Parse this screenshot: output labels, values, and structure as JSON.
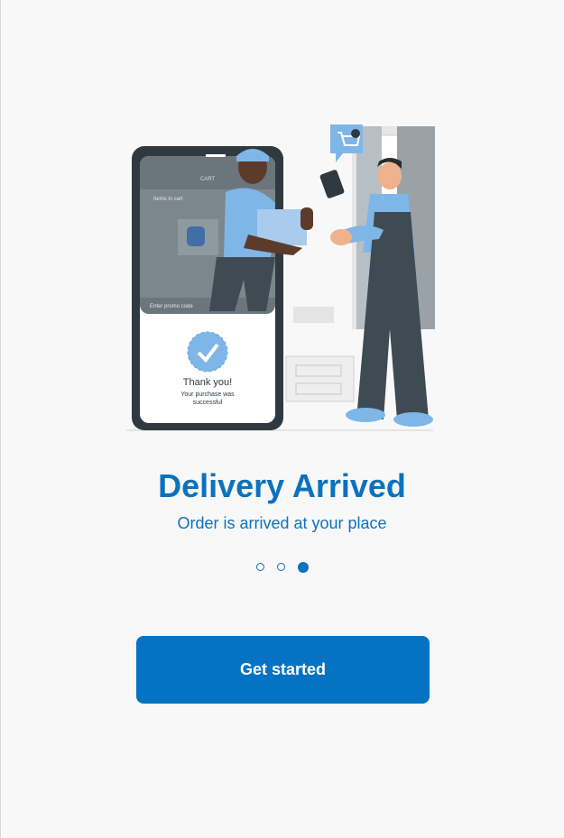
{
  "onboarding": {
    "title": "Delivery Arrived",
    "subtitle": "Order is arrived at your place",
    "page_count": 3,
    "active_page": 3,
    "cta_label": "Get started"
  },
  "illustration": {
    "phone_header": "CART",
    "phone_items_label": "Items in cart",
    "phone_promo_label": "Enter promo code",
    "thank_you_title": "Thank you!",
    "thank_you_line1": "Your purchase was",
    "thank_you_line2": "successful"
  },
  "colors": {
    "accent": "#0673c2",
    "title": "#0d72bd",
    "light_blue": "#7fb6e8",
    "dark_slate": "#3f4b52",
    "background": "#f8f8f8"
  }
}
